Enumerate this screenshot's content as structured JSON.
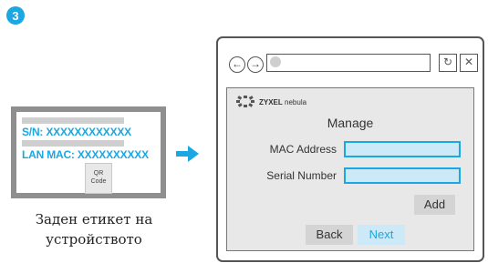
{
  "step": {
    "number": "3"
  },
  "device_label": {
    "sn": "S/N: XXXXXXXXXXXX",
    "lan_mac": "LAN MAC: XXXXXXXXXX",
    "qr_line1": "QR",
    "qr_line2": "Code",
    "caption_line1": "Заден етикет на",
    "caption_line2": "устройството"
  },
  "browser": {
    "brand": "ZYXEL",
    "brand_sub": "nebula",
    "heading": "Manage",
    "mac_label": "MAC Address",
    "serial_label": "Serial Number",
    "add_label": "Add",
    "back_label": "Back",
    "next_label": "Next"
  },
  "colors": {
    "accent": "#1aa7e2",
    "input_fill": "#cce9f7",
    "panel_bg": "#e8e8e8"
  }
}
